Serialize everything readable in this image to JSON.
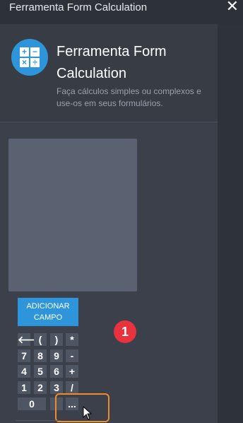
{
  "window": {
    "title": "Ferramenta Form Calculation",
    "close_glyph": "✕"
  },
  "header": {
    "icon": "calculator-icon",
    "icon_symbols": [
      "+",
      "−",
      "×",
      "÷"
    ],
    "title_line1": "Ferramenta Form",
    "title_line2": "Calculation",
    "description": "Faça cálculos simples ou complexos e use-os em seus formulários."
  },
  "builder": {
    "add_field_line1": "ADICIONAR",
    "add_field_line2": "CAMPO"
  },
  "annotation": {
    "badge": "1",
    "highlight_color": "#f08b2c"
  },
  "keypad": {
    "row1": [
      "🡐",
      "(",
      ")",
      "*"
    ],
    "row2": [
      "7",
      "8",
      "9",
      "-"
    ],
    "row3": [
      "4",
      "5",
      "6",
      "+"
    ],
    "row4": [
      "1",
      "2",
      "3",
      "/"
    ],
    "row5": [
      "0",
      "",
      "..."
    ]
  },
  "colors": {
    "background": "#3b404a",
    "accent": "#2f95db",
    "badge": "#e8333f"
  }
}
